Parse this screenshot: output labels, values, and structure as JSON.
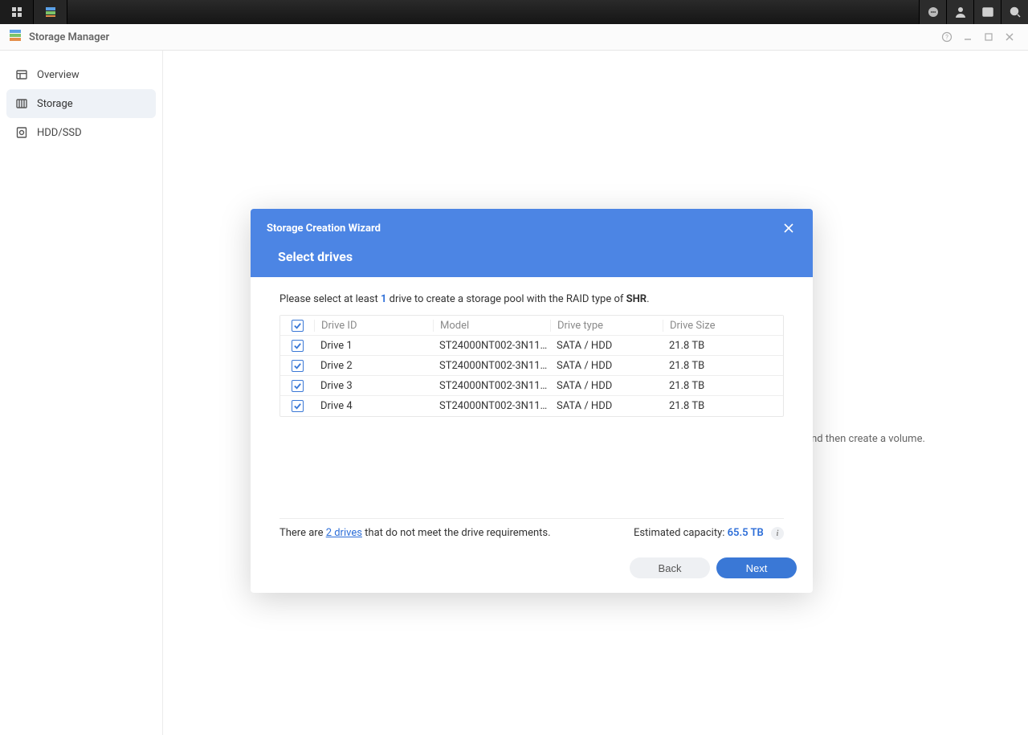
{
  "taskbar": {},
  "window": {
    "title": "Storage Manager"
  },
  "sidebar": {
    "items": [
      {
        "label": "Overview"
      },
      {
        "label": "Storage"
      },
      {
        "label": "HDD/SSD"
      }
    ]
  },
  "background_hint_fragment": " and then create a volume.",
  "modal": {
    "title": "Storage Creation Wizard",
    "subtitle": "Select drives",
    "instruction": {
      "prefix": "Please select at least ",
      "min_count": "1",
      "mid": " drive to create a storage pool with the RAID type of ",
      "raid_type": "SHR",
      "suffix": "."
    },
    "table": {
      "headers": {
        "id": "Drive ID",
        "model": "Model",
        "type": "Drive type",
        "size": "Drive Size"
      },
      "rows": [
        {
          "checked": true,
          "id": "Drive 1",
          "model": "ST24000NT002-3N11…",
          "type": "SATA / HDD",
          "size": "21.8 TB"
        },
        {
          "checked": true,
          "id": "Drive 2",
          "model": "ST24000NT002-3N11…",
          "type": "SATA / HDD",
          "size": "21.8 TB"
        },
        {
          "checked": true,
          "id": "Drive 3",
          "model": "ST24000NT002-3N11…",
          "type": "SATA / HDD",
          "size": "21.8 TB"
        },
        {
          "checked": true,
          "id": "Drive 4",
          "model": "ST24000NT002-3N11…",
          "type": "SATA / HDD",
          "size": "21.8 TB"
        }
      ]
    },
    "unmet": {
      "prefix": "There are ",
      "link": "2 drives",
      "suffix": " that do not meet the drive requirements."
    },
    "capacity": {
      "label": "Estimated capacity: ",
      "value": "65.5 TB"
    },
    "buttons": {
      "back": "Back",
      "next": "Next"
    }
  }
}
